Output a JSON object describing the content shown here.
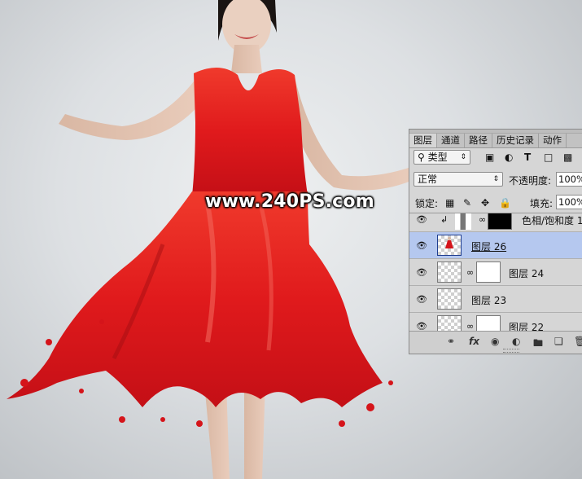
{
  "watermark": "www.240PS.com",
  "panel": {
    "tabs": [
      "图层",
      "通道",
      "路径",
      "历史记录",
      "动作"
    ],
    "active_tab": 0,
    "filter_label": "类型",
    "filter_icons": [
      "image-filter-icon",
      "adjustment-filter-icon",
      "text-filter-icon",
      "shape-filter-icon",
      "smart-object-filter-icon"
    ],
    "blend_mode": "正常",
    "opacity_label": "不透明度:",
    "opacity_value": "100%",
    "lock_label": "锁定:",
    "fill_label": "填充:",
    "fill_value": "100%",
    "layers": [
      {
        "name": "色相/饱和度 1",
        "selected": false,
        "kind": "adjustment"
      },
      {
        "name": "图层 26",
        "selected": true,
        "kind": "pixel"
      },
      {
        "name": "图层 24",
        "selected": false,
        "kind": "masked"
      },
      {
        "name": "图层 23",
        "selected": false,
        "kind": "pixel"
      },
      {
        "name": "图层 22",
        "selected": false,
        "kind": "masked"
      }
    ],
    "footer_icons": [
      "link-icon",
      "fx-icon",
      "mask-icon",
      "adjustment-icon",
      "folder-icon",
      "new-layer-icon",
      "trash-icon"
    ],
    "fx_label": "fx"
  },
  "colors": {
    "dress": "#e3161b",
    "selected_row": "#b5c8ef",
    "panel_bg": "#d6d6d6"
  }
}
